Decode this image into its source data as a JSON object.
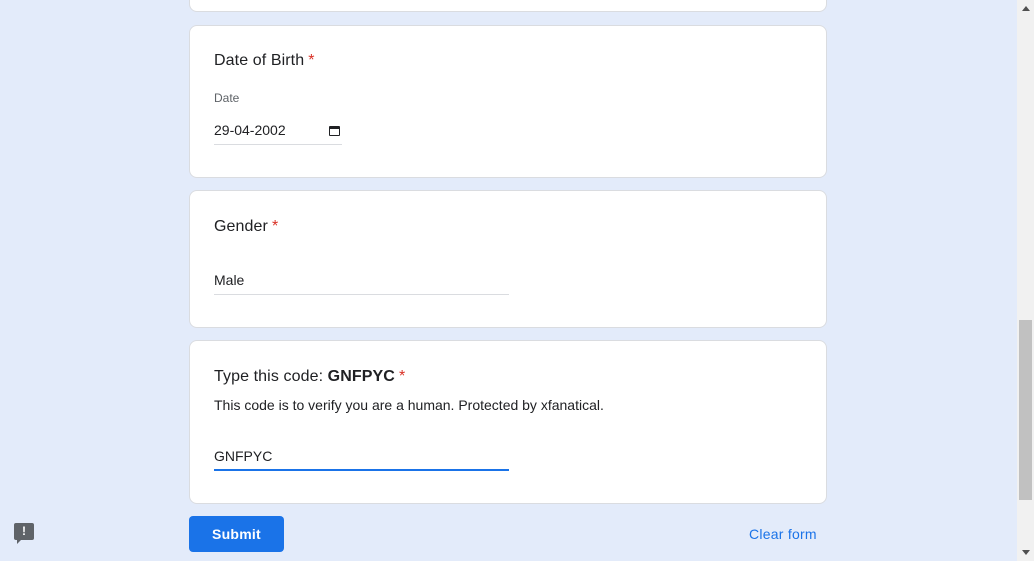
{
  "form": {
    "dob": {
      "title": "Date of Birth",
      "required_mark": "*",
      "sub_label": "Date",
      "value": "29-04-2002"
    },
    "gender": {
      "title": "Gender",
      "required_mark": "*",
      "value": "Male"
    },
    "captcha": {
      "title_prefix": "Type this code: ",
      "code": "GNFPYC",
      "required_mark": "*",
      "help": "This code is to verify you are a human. Protected by xfanatical.",
      "value": "GNFPYC"
    },
    "submit_label": "Submit",
    "clear_label": "Clear form"
  },
  "feedback": {
    "icon_glyph": "!"
  },
  "colors": {
    "background": "#e3ebfa",
    "accent": "#1a73e8",
    "required": "#d93025"
  },
  "icons": {
    "calendar": "calendar-icon",
    "feedback": "report-feedback-icon"
  },
  "scrollbar": {
    "position_fraction": 0.58
  }
}
